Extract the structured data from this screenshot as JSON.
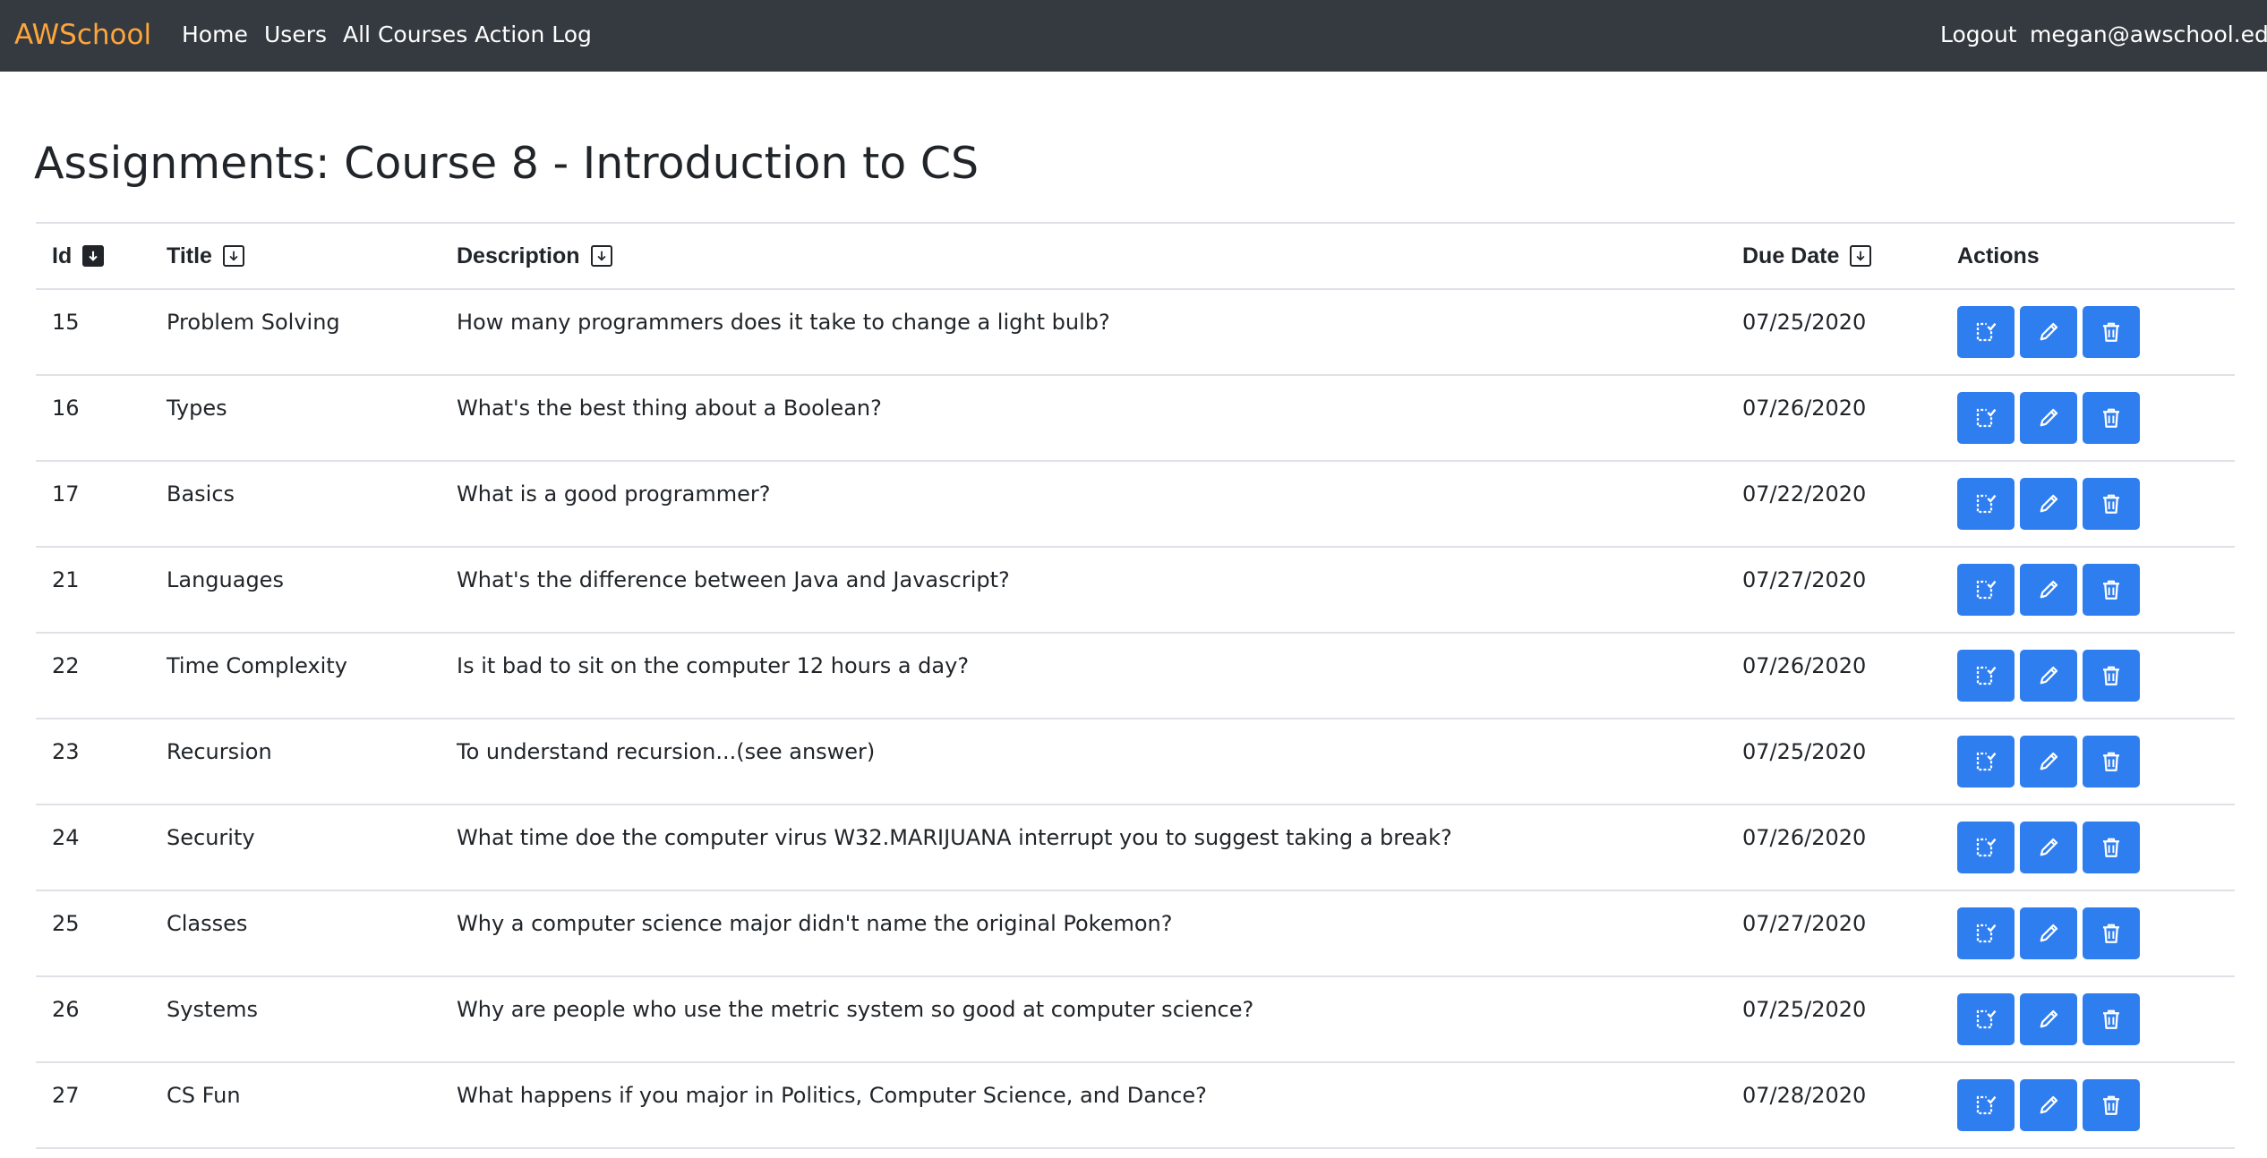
{
  "navbar": {
    "brand": "AWSchool",
    "links": [
      "Home",
      "Users",
      "All Courses",
      "Action Log"
    ],
    "logout": "Logout",
    "user_email": "megan@awschool.edu"
  },
  "page": {
    "title": "Assignments: Course 8 - Introduction to CS"
  },
  "table": {
    "columns": [
      "Id",
      "Title",
      "Description",
      "Due Date",
      "Actions"
    ],
    "rows": [
      {
        "id": "15",
        "title": "Problem Solving",
        "description": "How many programmers does it take to change a light bulb?",
        "due_date": "07/25/2020"
      },
      {
        "id": "16",
        "title": "Types",
        "description": "What's the best thing about a Boolean?",
        "due_date": "07/26/2020"
      },
      {
        "id": "17",
        "title": "Basics",
        "description": "What is a good programmer?",
        "due_date": "07/22/2020"
      },
      {
        "id": "21",
        "title": "Languages",
        "description": "What's the difference between Java and Javascript?",
        "due_date": "07/27/2020"
      },
      {
        "id": "22",
        "title": "Time Complexity",
        "description": "Is it bad to sit on the computer 12 hours a day?",
        "due_date": "07/26/2020"
      },
      {
        "id": "23",
        "title": "Recursion",
        "description": "To understand recursion...(see answer)",
        "due_date": "07/25/2020"
      },
      {
        "id": "24",
        "title": "Security",
        "description": "What time doe the computer virus W32.MARIJUANA interrupt you to suggest taking a break?",
        "due_date": "07/26/2020"
      },
      {
        "id": "25",
        "title": "Classes",
        "description": "Why a computer science major didn't name the original Pokemon?",
        "due_date": "07/27/2020"
      },
      {
        "id": "26",
        "title": "Systems",
        "description": "Why are people who use the metric system so good at computer science?",
        "due_date": "07/25/2020"
      },
      {
        "id": "27",
        "title": "CS Fun",
        "description": "What happens if you major in Politics, Computer Science, and Dance?",
        "due_date": "07/28/2020"
      }
    ]
  },
  "colors": {
    "navbar_bg": "#343a40",
    "brand": "#ffa53a",
    "button": "#2f7ef0"
  },
  "icons": {
    "sort_active": "sort-down-filled-icon",
    "sort": "sort-down-outline-icon",
    "submissions": "checklist-icon",
    "edit": "pencil-icon",
    "delete": "trash-icon"
  }
}
